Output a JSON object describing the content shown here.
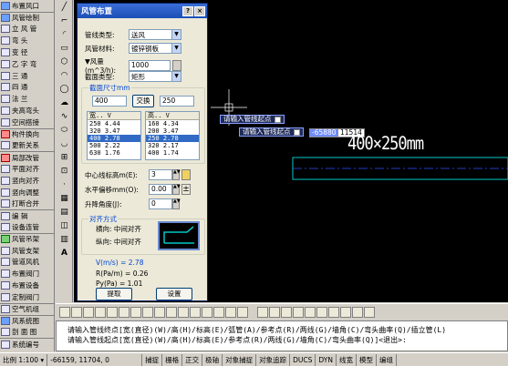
{
  "menu": [
    {
      "label": "布置风口",
      "style": "blue"
    },
    {
      "label": "风管绘制",
      "style": "blue",
      "sep": true
    },
    {
      "label": "立 风 管",
      "style": ""
    },
    {
      "label": "弯    头",
      "style": ""
    },
    {
      "label": "变    径",
      "style": ""
    },
    {
      "label": "乙 字 弯",
      "style": ""
    },
    {
      "label": "三    通",
      "style": ""
    },
    {
      "label": "四    通",
      "style": ""
    },
    {
      "label": "法    兰",
      "style": ""
    },
    {
      "label": "夹高弯头",
      "style": ""
    },
    {
      "label": "空间搭接",
      "style": ""
    },
    {
      "label": "构件换向",
      "style": "red",
      "sep": true
    },
    {
      "label": "更新关系",
      "style": ""
    },
    {
      "label": "局部改管",
      "style": "red",
      "sep": true
    },
    {
      "label": "平面对齐",
      "style": ""
    },
    {
      "label": "竖向对齐",
      "style": ""
    },
    {
      "label": "竖向调整",
      "style": ""
    },
    {
      "label": "打断合并",
      "style": ""
    },
    {
      "label": "编    辑",
      "style": "",
      "sep": true
    },
    {
      "label": "设备连管",
      "style": ""
    },
    {
      "label": "风管吊架",
      "style": "green",
      "sep": true
    },
    {
      "label": "风管支架",
      "style": ""
    },
    {
      "label": "管道风机",
      "style": ""
    },
    {
      "label": "布置阀门",
      "style": ""
    },
    {
      "label": "布置设备",
      "style": ""
    },
    {
      "label": "定制阀门",
      "style": ""
    },
    {
      "label": "空气机组",
      "style": "",
      "sep": true
    },
    {
      "label": "风系统图",
      "style": "blue",
      "sep": true
    },
    {
      "label": "剖 面 图",
      "style": ""
    },
    {
      "label": "系统编号",
      "style": "",
      "sep": true
    }
  ],
  "dialog": {
    "title": "风管布置",
    "title_buttons": [
      "?",
      "×"
    ],
    "system_type_label": "管线类型:",
    "system_type": "送风",
    "material_label": "风管材料:",
    "material": "镀锌钢板",
    "airflow_label": "▼风量(m^3/h):",
    "airflow": "1000",
    "section_type_label": "截面类型:",
    "section_type": "矩形",
    "section_size_label": "截面尺寸mm",
    "width_value": "400",
    "swap_button": "交换",
    "height_value": "250",
    "width_list_head": "宽..  V",
    "height_list_head": "高..  V",
    "width_rows": [
      "250  4.44",
      "320  3.47",
      "400  2.78",
      "500  2.22",
      "630  1.76"
    ],
    "height_rows": [
      "160  4.34",
      "200  3.47",
      "250  2.78",
      "320  2.17",
      "400  1.74"
    ],
    "selected_row": 2,
    "center_label": "中心线标高m(E):",
    "center_value": "3",
    "offset_label": "水平偏移mm(O):",
    "offset_value": "0.00",
    "angle_label": "升降角度(J):",
    "angle_value": "0",
    "align_label": "对齐方式",
    "align_h": "横向: 中间对齐",
    "align_v": "纵向: 中间对齐",
    "velocity": "V(m/s) = 2.78",
    "resistance": "R(Pa/m) = 0.26",
    "pressure": "Py(Pa) = 1.01",
    "extract_button": "提取",
    "settings_button": "设置"
  },
  "canvas": {
    "tip1": "请输入管线起点",
    "tip2": "请输入管线起点",
    "coord_x": "-65880",
    "coord_y": "11514",
    "dimension_text": "400×250mm"
  },
  "command": {
    "line1": "请输入管线终点[宽(直径)(W)/高(H)/标高(E)/弧管(A)/参考点(R)/两线(G)/墙角(C)/弯头曲率(Q)/插立管(L)",
    "line2": "请输入管线起点[宽(直径)(W)/高(H)/标高(E)/参考点(R)/两线(G)/墙角(C)/弯头曲率(Q)]<退出>:"
  },
  "status": {
    "scale": "比例 1:100 ▾",
    "coords": "-66159, 11704, 0",
    "toggles": [
      "捕捉",
      "栅格",
      "正交",
      "极轴",
      "对象捕捉",
      "对象追踪",
      "DUCS",
      "DYN",
      "线宽",
      "模型",
      "编组"
    ]
  },
  "colors": {
    "canvas_bg": "#000000",
    "duct_line": "#00c8c8",
    "dialog_title": "#1b4fb5"
  }
}
